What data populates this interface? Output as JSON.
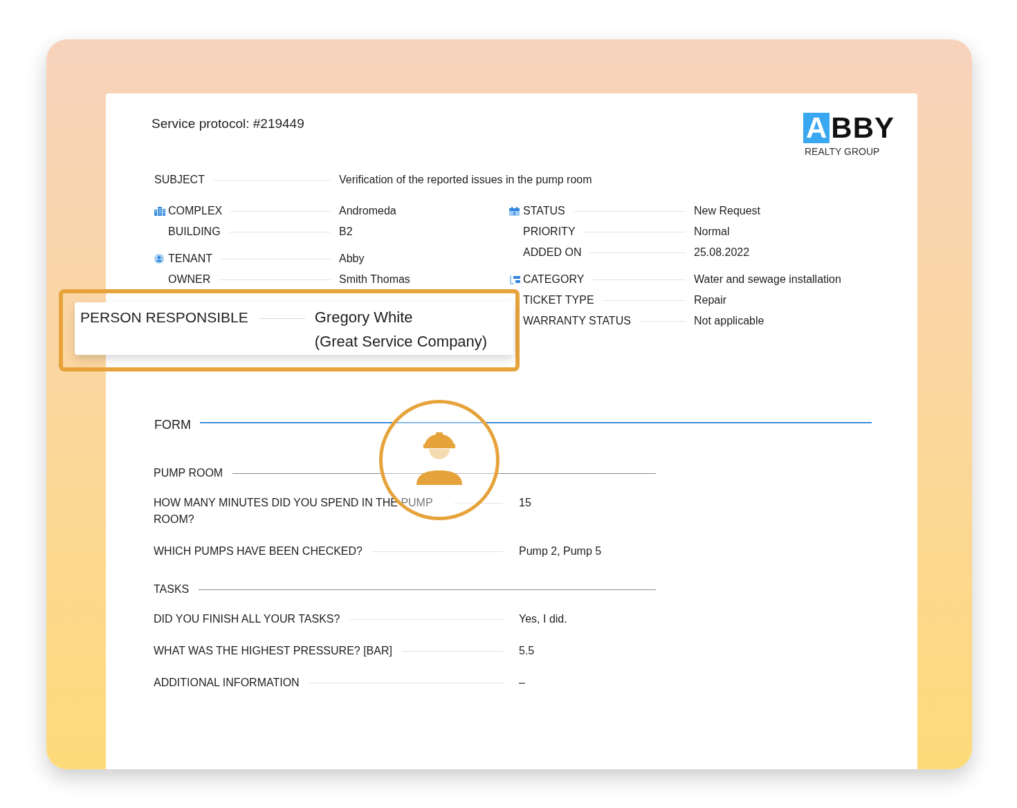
{
  "document": {
    "title": "Service protocol: #219449",
    "logo": {
      "mark": "A",
      "name": "BBY",
      "tagline": "REALTY GROUP"
    },
    "subject": {
      "label": "SUBJECT",
      "value": "Verification of the reported issues in the pump room"
    },
    "details_left": [
      {
        "fields": [
          {
            "label": "COMPLEX",
            "value": "Andromeda"
          },
          {
            "label": "BUILDING",
            "value": "B2"
          }
        ]
      },
      {
        "fields": [
          {
            "label": "TENANT",
            "value": "Abby"
          },
          {
            "label": "OWNER",
            "value": "Smith Thomas"
          }
        ]
      }
    ],
    "details_right": [
      {
        "fields": [
          {
            "label": "STATUS",
            "value": "New Request"
          },
          {
            "label": "PRIORITY",
            "value": "Normal"
          },
          {
            "label": "ADDED ON",
            "value": "25.08.2022"
          }
        ]
      },
      {
        "fields": [
          {
            "label": "CATEGORY",
            "value": "Water and sewage installation"
          },
          {
            "label": "TICKET TYPE",
            "value": "Repair"
          },
          {
            "label": "WARRANTY STATUS",
            "value": "Not applicable"
          }
        ]
      }
    ],
    "form": {
      "title": "FORM",
      "sections": [
        {
          "title": "PUMP ROOM",
          "rows": [
            {
              "question": "HOW MANY MINUTES DID YOU SPEND IN THE PUMP ROOM?",
              "answer": "15"
            },
            {
              "question": "WHICH PUMPS HAVE BEEN CHECKED?",
              "answer": "Pump 2, Pump 5"
            }
          ]
        },
        {
          "title": "TASKS",
          "rows": [
            {
              "question": "DID YOU FINISH ALL YOUR TASKS?",
              "answer": "Yes, I did."
            },
            {
              "question": "WHAT WAS THE HIGHEST PRESSURE? [BAR]",
              "answer": "5.5"
            },
            {
              "question": "ADDITIONAL INFORMATION",
              "answer": "–"
            }
          ]
        }
      ]
    }
  },
  "callout": {
    "label": "PERSON RESPONSIBLE",
    "value_lines": [
      "Gregory White",
      "(Great Service Company)"
    ]
  }
}
